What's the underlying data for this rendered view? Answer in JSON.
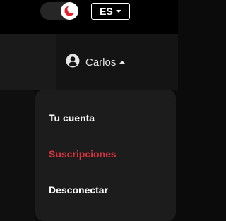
{
  "theme_toggle": {
    "icon": "moon-icon",
    "accent": "#e3202b"
  },
  "language": {
    "label": "ES",
    "icon": "caret-down-icon"
  },
  "user_menu": {
    "name": "Carlos",
    "avatar_icon": "user-circle-icon",
    "caret_icon": "caret-up-icon",
    "items": [
      {
        "label": "Tu cuenta"
      },
      {
        "label": "Suscripciones",
        "active": true,
        "color": "#d1343f"
      },
      {
        "label": "Desconectar"
      }
    ]
  }
}
